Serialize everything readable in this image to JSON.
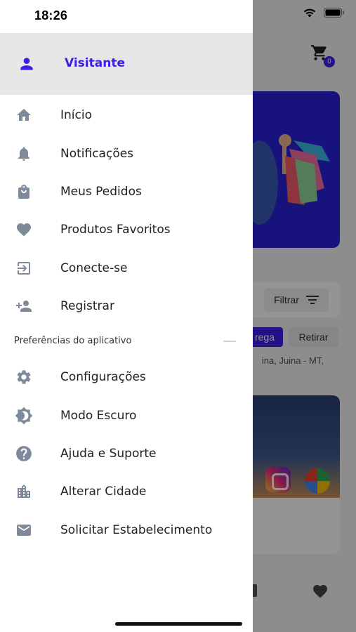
{
  "status_bar": {
    "time": "18:26"
  },
  "drawer": {
    "user": {
      "name": "Visitante",
      "icon": "person-icon"
    },
    "menu_items": [
      {
        "label": "Início",
        "icon": "home-icon"
      },
      {
        "label": "Notificações",
        "icon": "bell-icon"
      },
      {
        "label": "Meus Pedidos",
        "icon": "shopping-bag-icon"
      },
      {
        "label": "Produtos Favoritos",
        "icon": "heart-icon"
      },
      {
        "label": "Conecte-se",
        "icon": "login-icon"
      },
      {
        "label": "Registrar",
        "icon": "add-person-icon"
      }
    ],
    "preferences_section": {
      "title": "Preferências do aplicativo",
      "items": [
        {
          "label": "Configurações",
          "icon": "gear-icon"
        },
        {
          "label": "Modo Escuro",
          "icon": "brightness-icon"
        },
        {
          "label": "Ajuda e Suporte",
          "icon": "help-icon"
        },
        {
          "label": "Alterar Cidade",
          "icon": "city-icon"
        },
        {
          "label": "Solicitar Estabelecimento",
          "icon": "mail-icon"
        }
      ]
    }
  },
  "background": {
    "cart_badge": "0",
    "filter_label": "Filtrar",
    "delivery_chip": "rega",
    "pickup_chip": "Retirar",
    "address": "ina, Juina - MT,"
  },
  "colors": {
    "accent": "#3b1ee8",
    "icon_gray": "#7e8a9a",
    "header_bg": "#e7e7e7"
  }
}
